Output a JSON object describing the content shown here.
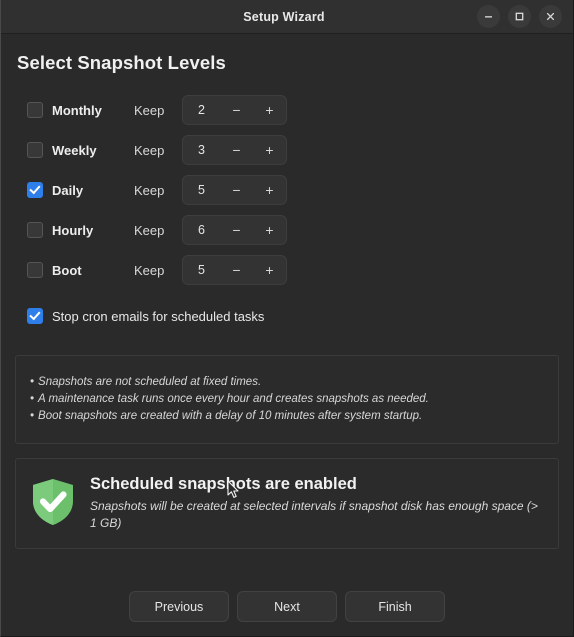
{
  "window": {
    "title": "Setup Wizard",
    "controls": [
      {
        "name": "minimize",
        "glyph": "minimize-icon"
      },
      {
        "name": "maximize",
        "glyph": "maximize-icon"
      },
      {
        "name": "close",
        "glyph": "close-icon"
      }
    ]
  },
  "page": {
    "heading": "Select Snapshot Levels"
  },
  "levels": [
    {
      "label": "Monthly",
      "checked": false,
      "keep_label": "Keep",
      "value": "2",
      "minus": "−",
      "plus": "+"
    },
    {
      "label": "Weekly",
      "checked": false,
      "keep_label": "Keep",
      "value": "3",
      "minus": "−",
      "plus": "+"
    },
    {
      "label": "Daily",
      "checked": true,
      "keep_label": "Keep",
      "value": "5",
      "minus": "−",
      "plus": "+"
    },
    {
      "label": "Hourly",
      "checked": false,
      "keep_label": "Keep",
      "value": "6",
      "minus": "−",
      "plus": "+"
    },
    {
      "label": "Boot",
      "checked": false,
      "keep_label": "Keep",
      "value": "5",
      "minus": "−",
      "plus": "+"
    }
  ],
  "cron": {
    "label": "Stop cron emails for scheduled tasks",
    "checked": true
  },
  "info": {
    "lines": [
      "Snapshots are not scheduled at fixed times.",
      "A maintenance task runs once every hour and creates snapshots as needed.",
      "Boot snapshots are created with a delay of 10 minutes after system startup."
    ],
    "bullet": "•"
  },
  "status": {
    "icon": "shield-check-icon",
    "title": "Scheduled snapshots are enabled",
    "subtitle": "Snapshots will be created at selected intervals if snapshot disk has enough space (> 1 GB)"
  },
  "footer": {
    "previous": "Previous",
    "next": "Next",
    "finish": "Finish"
  },
  "colors": {
    "accent_checkbox": "#2f7fea",
    "shield_green": "#6cc06c",
    "window_bg": "#2a2a2a",
    "titlebar_bg": "#303030"
  }
}
